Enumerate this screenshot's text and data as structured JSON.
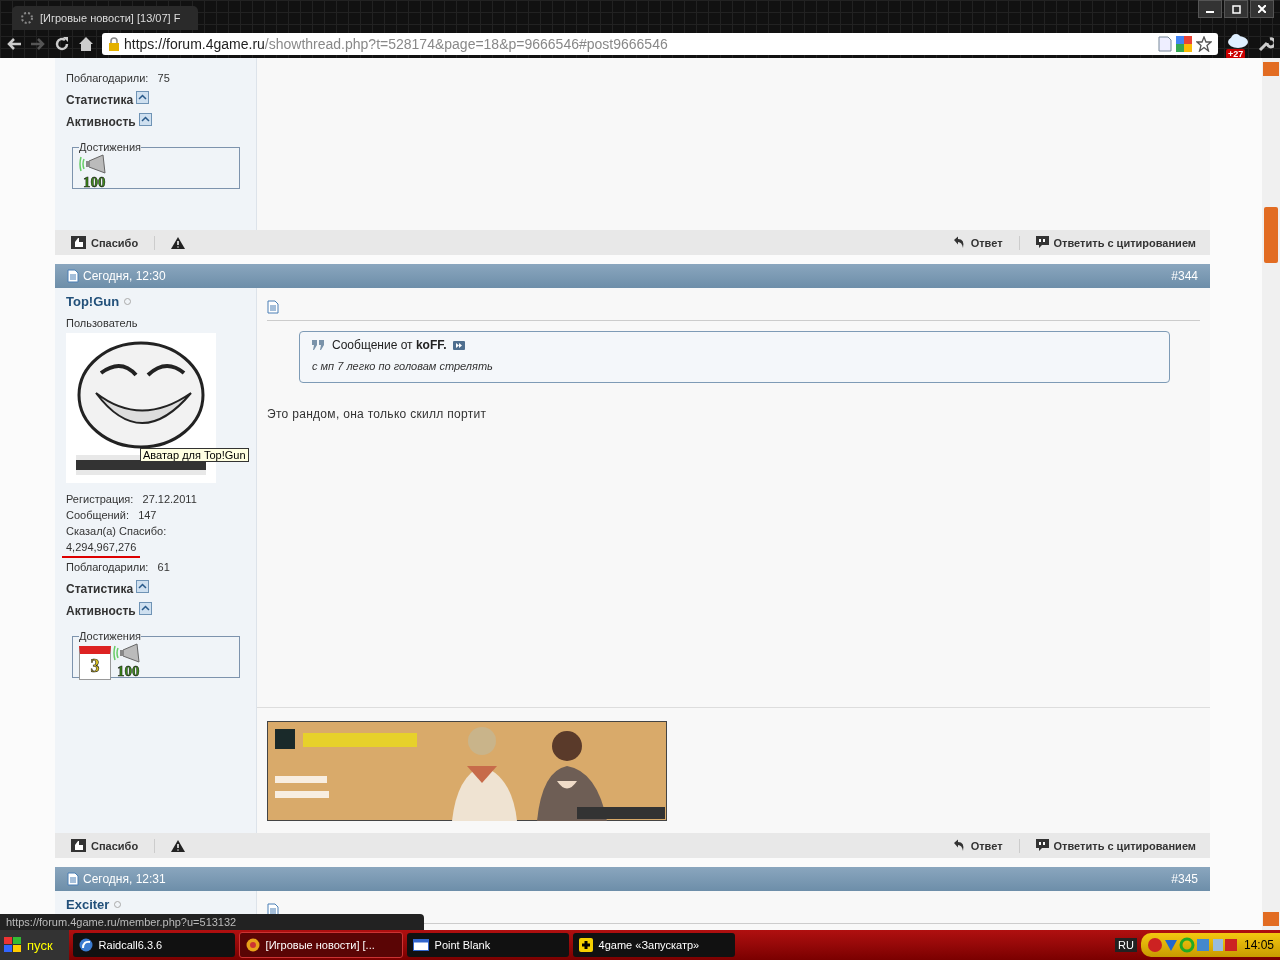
{
  "browser": {
    "tab_title": "[Игровые новости] [13/07] F",
    "url_host": "https://forum.4game.ru",
    "url_path": "/showthread.php?t=528174&page=18&p=9666546#post9666546",
    "weather_badge": "+27"
  },
  "posts": [
    {
      "kind": "tail",
      "user": {
        "stats": [
          {
            "label": "Поблагодарили:",
            "value": "75"
          }
        ],
        "sections": [
          "Статистика",
          "Активность"
        ],
        "achievements_title": "Достижения",
        "achievements": [
          {
            "kind": "megaphone",
            "label": "100"
          }
        ]
      },
      "footer": {
        "thanks": "Спасибо",
        "reply": "Ответ",
        "quote_reply": "Ответить с цитированием"
      }
    },
    {
      "kind": "full",
      "date": "Сегодня, 12:30",
      "number": "#344",
      "user": {
        "name": "Top!Gun",
        "role": "Пользователь",
        "avatar": {
          "kind": "picture"
        },
        "tooltip": "Аватар для Top!Gun",
        "stats": [
          {
            "label": "Регистрация:",
            "value": "27.12.2011"
          },
          {
            "label": "Сообщений:",
            "value": "147"
          },
          {
            "label": "Сказал(а) Спасибо:"
          },
          {
            "value": "4,294,967,276",
            "underlined": true
          },
          {
            "label": "Поблагодарили:",
            "value": "61"
          }
        ],
        "sections": [
          "Статистика",
          "Активность"
        ],
        "achievements_title": "Достижения",
        "achievements": [
          {
            "kind": "calendar",
            "label": "3"
          },
          {
            "kind": "megaphone",
            "label": "100"
          }
        ]
      },
      "quote": {
        "prefix": "Сообщение от",
        "author": "koFF.",
        "text": "с мп 7 легко по головам стрелять"
      },
      "message": "Это рандом, она только скилл портит",
      "signature": {
        "kind": "picture"
      },
      "footer": {
        "thanks": "Спасибо",
        "reply": "Ответ",
        "quote_reply": "Ответить с цитированием"
      }
    },
    {
      "kind": "head",
      "date": "Сегодня, 12:31",
      "number": "#345",
      "user": {
        "name": "Exciter"
      }
    }
  ],
  "status_url": "https://forum.4game.ru/member.php?u=513132",
  "taskbar": {
    "start": "пуск",
    "tasks": [
      {
        "label": "Raidcall6.3.6",
        "kind": "raidcall",
        "selected": false
      },
      {
        "label": "[Игровые новости] [...",
        "kind": "browser",
        "selected": true
      },
      {
        "label": "Point Blank",
        "kind": "window",
        "selected": false
      },
      {
        "label": "4game «Запускатр»",
        "kind": "game",
        "selected": false
      }
    ],
    "language": "RU",
    "clock": "14:05"
  }
}
